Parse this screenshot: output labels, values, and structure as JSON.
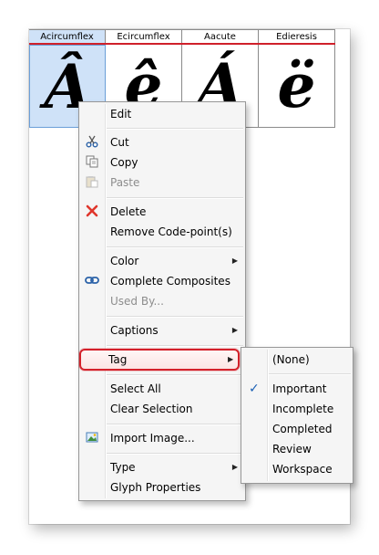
{
  "glyphs": [
    {
      "name": "Acircumflex",
      "char": "Â"
    },
    {
      "name": "Ecircumflex",
      "char": "ê"
    },
    {
      "name": "Aacute",
      "char": "Á"
    },
    {
      "name": "Edieresis",
      "char": "ë"
    }
  ],
  "context_menu": {
    "edit": "Edit",
    "cut": "Cut",
    "copy": "Copy",
    "paste": "Paste",
    "delete": "Delete",
    "remove_code_points": "Remove Code-point(s)",
    "color": "Color",
    "complete_composites": "Complete Composites",
    "used_by": "Used By...",
    "captions": "Captions",
    "tag": "Tag",
    "select_all": "Select All",
    "clear_selection": "Clear Selection",
    "import_image": "Import Image...",
    "type": "Type",
    "glyph_properties": "Glyph Properties"
  },
  "tag_submenu": {
    "none": "(None)",
    "important": "Important",
    "incomplete": "Incomplete",
    "completed": "Completed",
    "review": "Review",
    "workspace": "Workspace",
    "checked_item": "Important"
  },
  "colors": {
    "selection": "#cfe2f8",
    "header_rule": "#d0202a",
    "callout_border": "#d4202a"
  }
}
